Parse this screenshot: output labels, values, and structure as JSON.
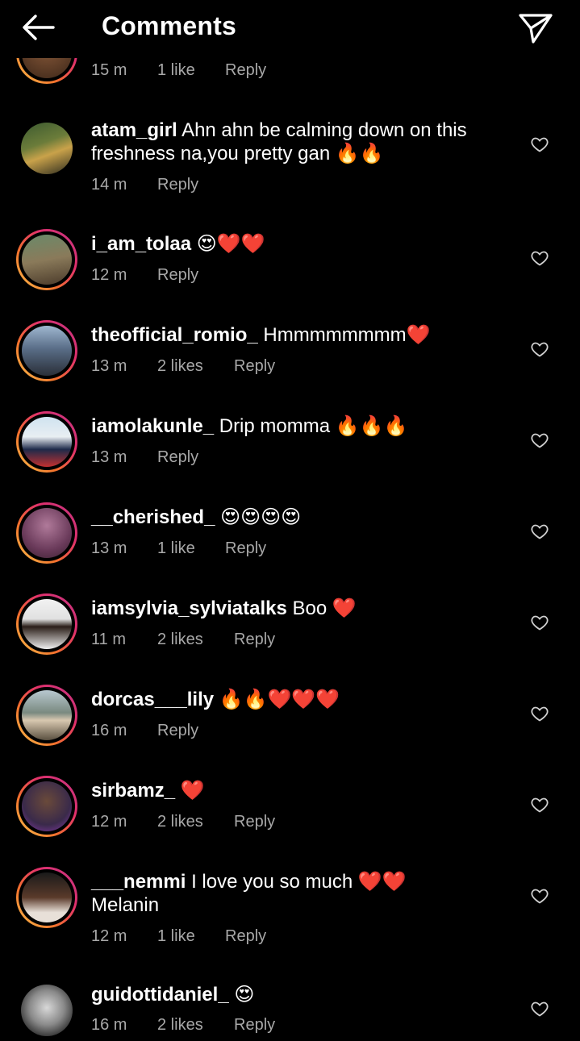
{
  "header": {
    "title": "Comments",
    "back_icon": "arrow-left-icon",
    "send_icon": "paper-plane-icon"
  },
  "colors": {
    "background": "#000000",
    "text": "#ffffff",
    "meta": "#a8a8a8"
  },
  "comments": [
    {
      "username": "",
      "text": "",
      "time": "15 m",
      "likes": "1 like",
      "reply": "Reply"
    },
    {
      "username": "atam_girl",
      "text": " Ahn ahn be calming down on this freshness na,you pretty gan 🔥🔥",
      "time": "14 m",
      "likes": "",
      "reply": "Reply"
    },
    {
      "username": "i_am_tolaa",
      "text": " 😍❤️❤️",
      "time": "12 m",
      "likes": "",
      "reply": "Reply"
    },
    {
      "username": "theofficial_romio_",
      "text": " Hmmmmmmmm❤️",
      "time": "13 m",
      "likes": "2 likes",
      "reply": "Reply"
    },
    {
      "username": "iamolakunle_",
      "text": " Drip momma 🔥🔥🔥",
      "time": "13 m",
      "likes": "",
      "reply": "Reply"
    },
    {
      "username": "__cherished_",
      "text": " 😍😍😍😍",
      "time": "13 m",
      "likes": "1 like",
      "reply": "Reply"
    },
    {
      "username": "iamsylvia_sylviatalks",
      "text": " Boo ❤️",
      "time": "11 m",
      "likes": "2 likes",
      "reply": "Reply"
    },
    {
      "username": "dorcas___lily",
      "text": " 🔥🔥❤️❤️❤️",
      "time": "16 m",
      "likes": "",
      "reply": "Reply"
    },
    {
      "username": "sirbamz_",
      "text": " ❤️",
      "time": "12 m",
      "likes": "2 likes",
      "reply": "Reply"
    },
    {
      "username": "___nemmi",
      "text": " I love you so much ❤️❤️ Melanin",
      "time": "12 m",
      "likes": "1 like",
      "reply": "Reply"
    },
    {
      "username": "guidottidaniel_",
      "text": " 😍",
      "time": "16 m",
      "likes": "2 likes",
      "reply": "Reply"
    }
  ]
}
